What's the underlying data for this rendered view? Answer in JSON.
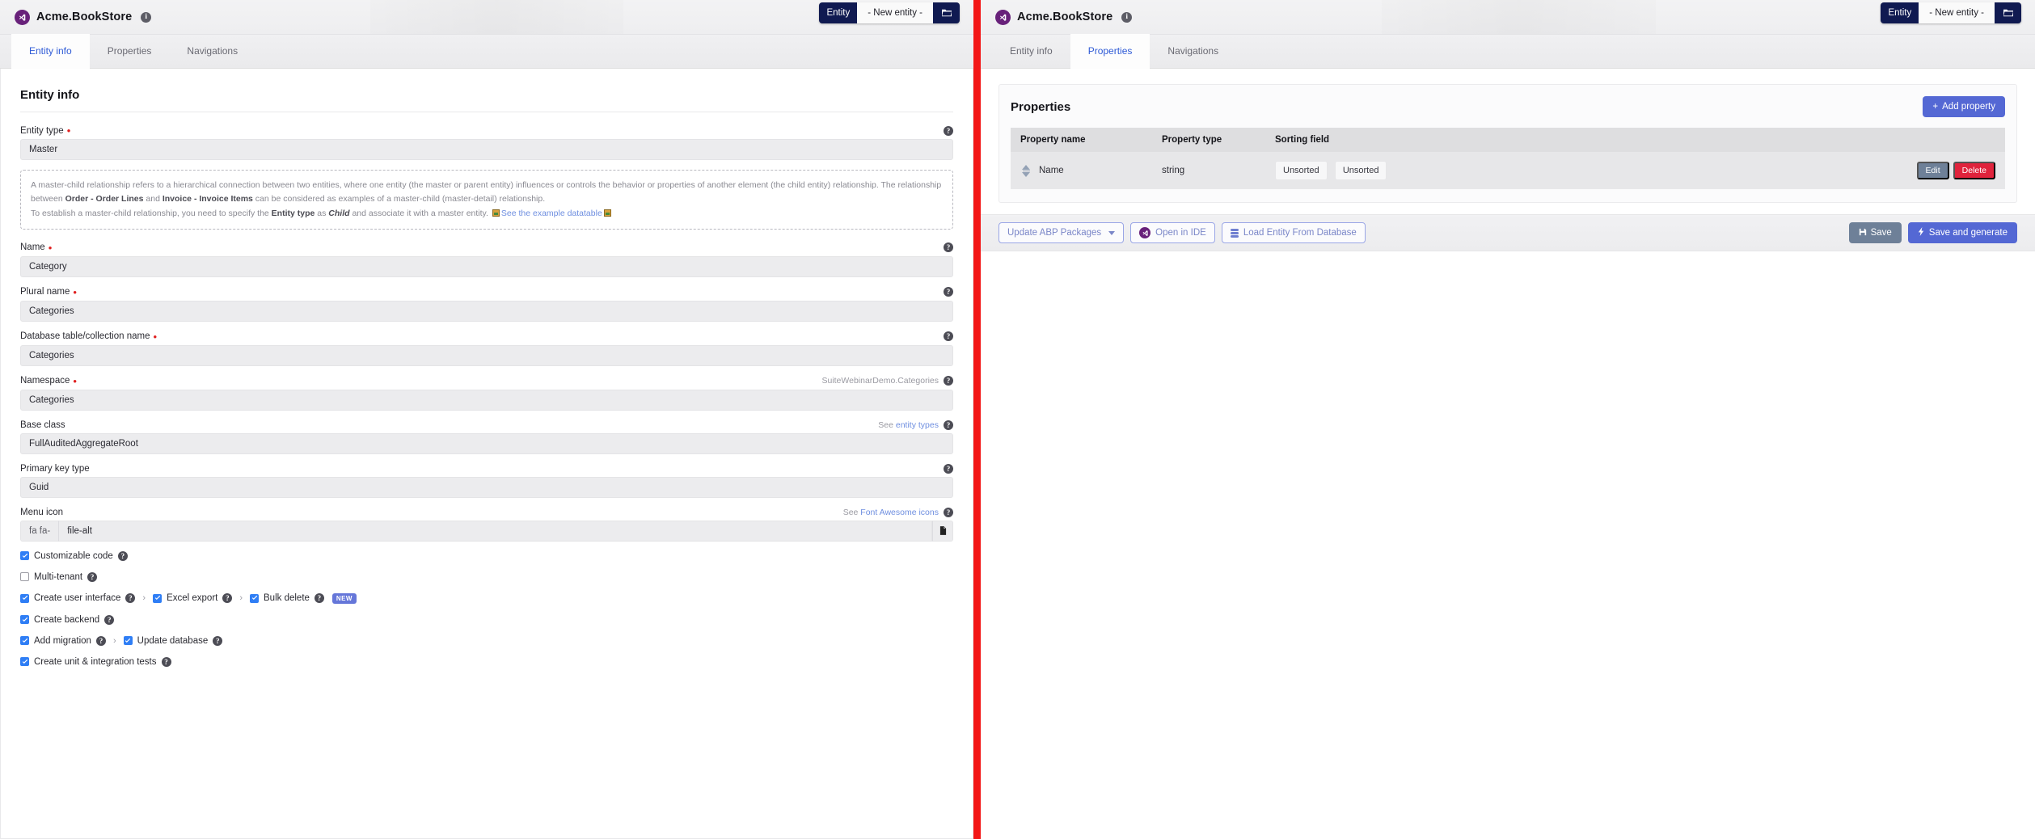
{
  "app": {
    "brand_title": "Acme.BookStore",
    "info_icon": "info-circle-icon",
    "logo_icon": "visual-studio-icon"
  },
  "entity_selector": {
    "label": "Entity",
    "selected": "- New entity -",
    "open_icon": "folder-open-icon"
  },
  "tabs": [
    {
      "label": "Entity info"
    },
    {
      "label": "Properties"
    },
    {
      "label": "Navigations"
    }
  ],
  "left_panel": {
    "active_tab": "Entity info",
    "card_title": "Entity info",
    "fields": [
      {
        "label": "Entity type",
        "required": true,
        "value": "Master",
        "hint": "",
        "hint_link": ""
      },
      {
        "label": "Name",
        "required": true,
        "value": "Category",
        "hint": "",
        "hint_link": ""
      },
      {
        "label": "Plural name",
        "required": true,
        "value": "Categories",
        "hint": "",
        "hint_link": ""
      },
      {
        "label": "Database table/collection name",
        "required": true,
        "value": "Categories",
        "hint": "",
        "hint_link": ""
      },
      {
        "label": "Namespace",
        "required": true,
        "value": "Categories",
        "hint": "SuiteWebinarDemo.Categories",
        "hint_link": ""
      },
      {
        "label": "Base class",
        "required": false,
        "value": "FullAuditedAggregateRoot",
        "hint": "See",
        "hint_link": "entity types"
      },
      {
        "label": "Primary key type",
        "required": false,
        "value": "Guid",
        "hint": "",
        "hint_link": ""
      }
    ],
    "note": {
      "p1_a": "A master-child relationship refers to a hierarchical connection between two entities, where one entity (the master or parent entity) influences or controls the behavior or properties of another element (the child entity) relationship. The relationship between ",
      "p1_b": "Order - Order Lines",
      "p1_c": " and ",
      "p1_d": "Invoice - Invoice Items",
      "p1_e": " can be considered as examples of a master-child (master-detail) relationship.",
      "p2_a": "To establish a master-child relationship, you need to specify the ",
      "p2_b": "Entity type",
      "p2_c": " as ",
      "p2_d": "Child",
      "p2_e": " and associate it with a master entity.",
      "p2_link": "See the example datatable"
    },
    "menu_icon_field": {
      "label": "Menu icon",
      "hint": "See",
      "hint_link": "Font Awesome icons",
      "prefix": "fa fa-",
      "value": "file-alt",
      "right_icon": "file-alt-icon"
    },
    "checkboxes": [
      {
        "label": "Customizable code",
        "checked": true,
        "help": true,
        "badge": "",
        "chain": false
      },
      {
        "label": "Multi-tenant",
        "checked": false,
        "help": true,
        "badge": "",
        "chain": false
      }
    ],
    "ui_chain": [
      {
        "label": "Create user interface",
        "checked": true,
        "help": true,
        "badge": ""
      },
      {
        "label": "Excel export",
        "checked": true,
        "help": true,
        "badge": ""
      },
      {
        "label": "Bulk delete",
        "checked": true,
        "help": true,
        "badge": "NEW"
      }
    ],
    "backend": {
      "label": "Create backend",
      "checked": true,
      "help": true
    },
    "migration_chain": [
      {
        "label": "Add migration",
        "checked": true,
        "help": true
      },
      {
        "label": "Update database",
        "checked": true,
        "help": true
      }
    ],
    "tests": {
      "label": "Create unit & integration tests",
      "checked": true,
      "help": true
    }
  },
  "right_panel": {
    "active_tab": "Properties",
    "section_title": "Properties",
    "add_button": {
      "label": "Add property",
      "icon": "plus-icon"
    },
    "table": {
      "columns": [
        "Property name",
        "Property type",
        "Sorting field",
        ""
      ],
      "rows": [
        {
          "name": "Name",
          "type": "string",
          "sorting": [
            "Unsorted",
            "Unsorted"
          ],
          "actions": [
            {
              "label": "Edit",
              "kind": "edit"
            },
            {
              "label": "Delete",
              "kind": "delete"
            }
          ]
        }
      ]
    },
    "actionbar": {
      "update_packages": {
        "label": "Update ABP Packages",
        "icon": "caret-down-icon"
      },
      "open_ide": {
        "label": "Open in IDE",
        "icon": "visual-studio-icon"
      },
      "load_entity": {
        "label": "Load Entity From Database",
        "icon": "database-icon"
      },
      "save": {
        "label": "Save",
        "icon": "save-icon"
      },
      "save_generate": {
        "label": "Save and generate",
        "icon": "bolt-icon"
      }
    }
  },
  "colors": {
    "accent_blue": "#5468d4",
    "navy": "#101a51",
    "danger_red": "#e0233c",
    "divider_red": "#f31616",
    "link_blue": "#6f8fe0",
    "tab_active": "#2f5bd6",
    "checkbox_blue": "#2f7ef5",
    "vs_purple": "#68217a"
  }
}
